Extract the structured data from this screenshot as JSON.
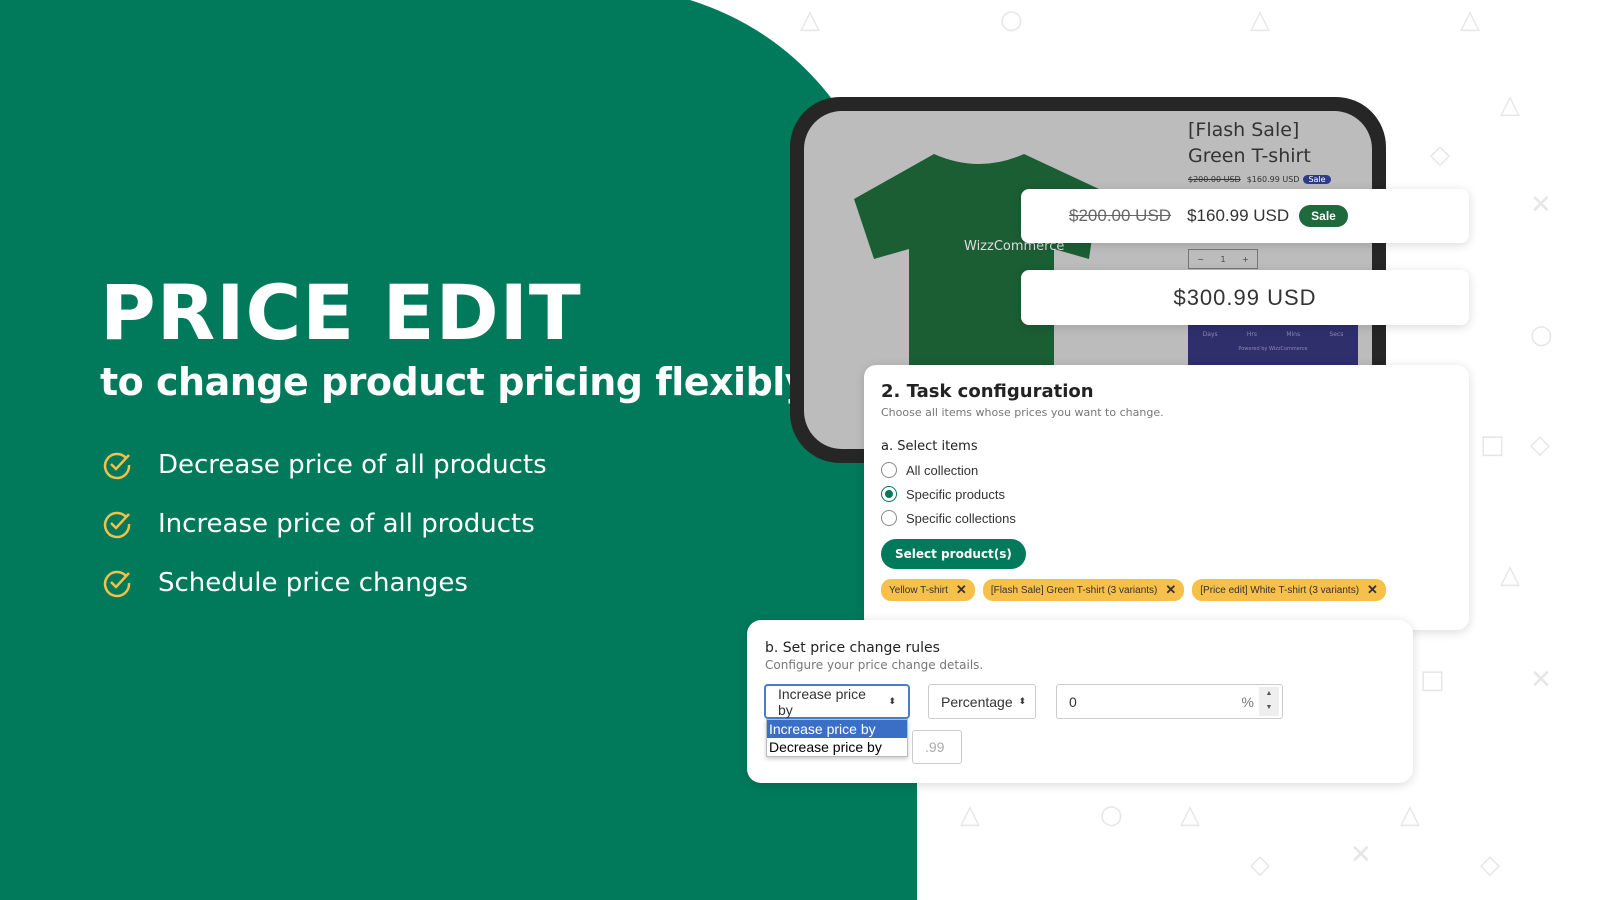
{
  "colors": {
    "brand": "#007a5a",
    "tag": "#f6c04a",
    "sale": "#1e6a3d"
  },
  "hero": {
    "title": "PRICE EDIT",
    "subtitle": "to change product pricing flexibly",
    "features": [
      {
        "icon": "check-circle-icon",
        "label": "Decrease price of all products"
      },
      {
        "icon": "check-circle-icon",
        "label": "Increase price of all products"
      },
      {
        "icon": "check-circle-icon",
        "label": "Schedule price changes"
      }
    ]
  },
  "product": {
    "title": "[Flash Sale] Green T-shirt",
    "brand": "WizzCommerce",
    "compare_price": "$200.00 USD",
    "price": "$160.99 USD",
    "sale_badge": "Sale",
    "quantity": "1",
    "timer_labels": [
      "Days",
      "Hrs",
      "Mins",
      "Secs"
    ],
    "powered_by": "Powered by WizzCommerce"
  },
  "price_card": {
    "compare_price": "$200.00 USD",
    "price": "$160.99 USD",
    "sale_badge": "Sale"
  },
  "new_price": {
    "price": "$300.99 USD"
  },
  "task": {
    "title": "2. Task configuration",
    "subtitle": "Choose all items whose prices you want to change.",
    "select_label": "a. Select items",
    "options": [
      {
        "label": "All collection",
        "checked": false
      },
      {
        "label": "Specific products",
        "checked": true
      },
      {
        "label": "Specific collections",
        "checked": false
      }
    ],
    "select_button": "Select product(s)",
    "tags": [
      "Yellow T-shirt",
      "[Flash Sale] Green T-shirt (3 variants)",
      "[Price edit] White T-shirt (3 variants)"
    ]
  },
  "rules": {
    "title": "b. Set price change rules",
    "subtitle": "Configure your price change details.",
    "action": "Increase price by",
    "type": "Percentage",
    "value": "0",
    "unit": "%",
    "rounding_placeholder": ".99",
    "action_options": [
      "Increase price by",
      "Decrease price by"
    ]
  }
}
